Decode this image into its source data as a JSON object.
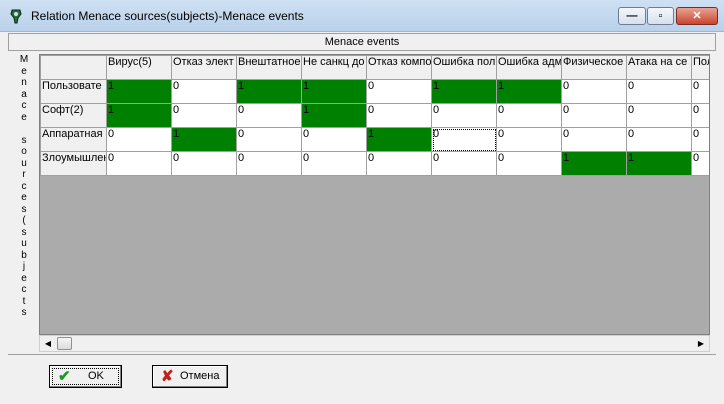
{
  "window": {
    "title": "Relation Menace sources(subjects)-Menace events",
    "controls": {
      "minimize": "—",
      "maximize": "▫",
      "close": "✕"
    }
  },
  "header": {
    "label": "Menace events"
  },
  "side_label": "Menace sources(subjects",
  "grid": {
    "columns": [
      "Вирус(5)",
      "Отказ электропитания",
      "Внештатное",
      "Не санкц доступ",
      "Отказ компонентов",
      "Ошибка пользователя",
      "Ошибка администратора",
      "Физическое",
      "Атака на сервер",
      "Пользователь"
    ],
    "columns_visible": [
      "Вирус(5)",
      "Отказ элект",
      "Внештатное",
      "Не санкц до",
      "Отказ компо",
      "Ошибка пол",
      "Ошибка адм",
      "Физическое",
      "Атака на се",
      "Пол"
    ],
    "rows": [
      {
        "label": "Пользовате",
        "values": [
          "1",
          "0",
          "1",
          "1",
          "0",
          "1",
          "1",
          "0",
          "0",
          "0"
        ]
      },
      {
        "label": "Софт(2)",
        "values": [
          "1",
          "0",
          "0",
          "1",
          "0",
          "0",
          "0",
          "0",
          "0",
          "0"
        ]
      },
      {
        "label": "Аппаратная",
        "values": [
          "0",
          "1",
          "0",
          "0",
          "1",
          "0",
          "0",
          "0",
          "0",
          "0"
        ]
      },
      {
        "label": "Злоумышлен",
        "values": [
          "0",
          "0",
          "0",
          "0",
          "0",
          "0",
          "0",
          "1",
          "1",
          "0"
        ]
      }
    ],
    "focused_cell": {
      "row": 2,
      "col": 5
    }
  },
  "buttons": {
    "ok": "OK",
    "cancel": "Отмена"
  },
  "colors": {
    "active_cell": "#008000",
    "inactive_cell": "#ffffff"
  }
}
